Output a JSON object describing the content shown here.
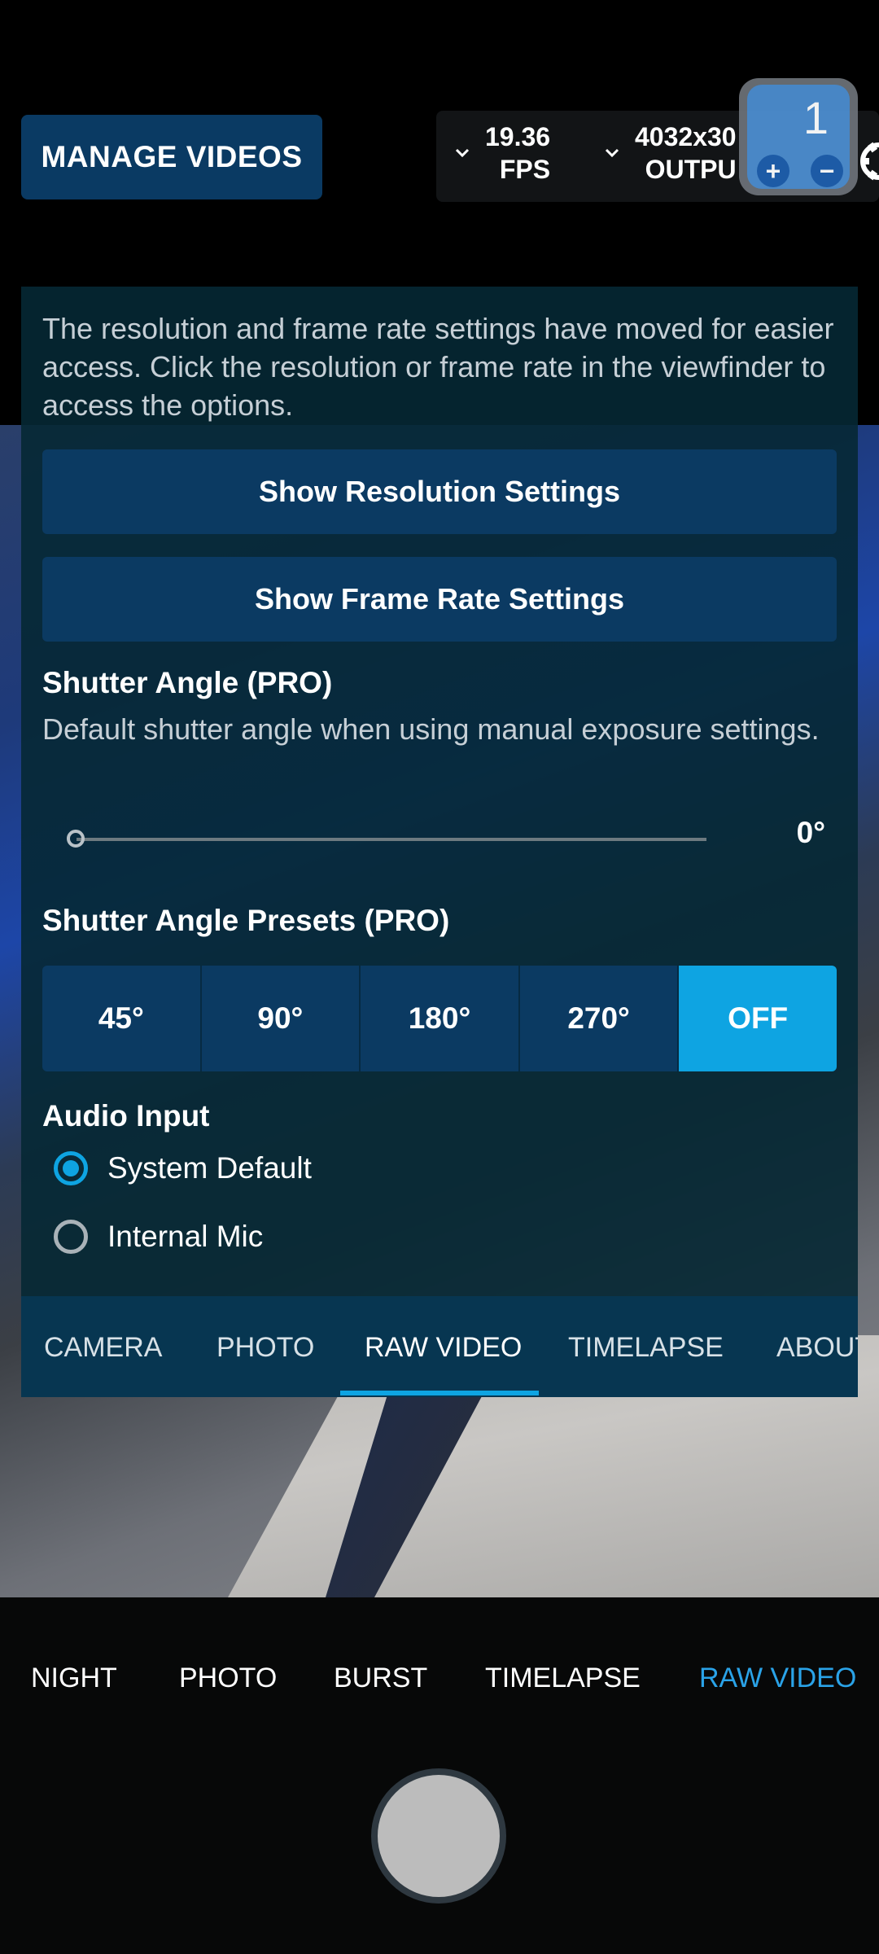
{
  "header": {
    "manage_videos_label": "MANAGE VIDEOS",
    "fps_value": "19.36",
    "fps_unit": "FPS",
    "resolution_value": "4032x30",
    "resolution_unit": "OUTPU",
    "counter_value": "1",
    "counter_plus": "+",
    "counter_minus": "−"
  },
  "panel": {
    "notice": "The resolution and frame rate settings have moved for easier access. Click the resolution or frame rate in the viewfinder to access the options.",
    "show_resolution_label": "Show Resolution Settings",
    "show_frame_rate_label": "Show Frame Rate Settings",
    "shutter_angle": {
      "title": "Shutter Angle (PRO)",
      "description": "Default shutter angle when using manual exposure settings.",
      "value_label": "0°",
      "value": 0
    },
    "presets": {
      "title": "Shutter Angle Presets (PRO)",
      "options": [
        "45°",
        "90°",
        "180°",
        "270°",
        "OFF"
      ],
      "selected": "OFF"
    },
    "audio": {
      "title": "Audio Input",
      "options": [
        "System Default",
        "Internal Mic"
      ],
      "selected": "System Default"
    },
    "tabs": [
      "CAMERA",
      "PHOTO",
      "RAW VIDEO",
      "TIMELAPSE",
      "ABOUT"
    ],
    "active_tab": "RAW VIDEO"
  },
  "modes": {
    "items": [
      "NIGHT",
      "PHOTO",
      "BURST",
      "TIMELAPSE",
      "RAW VIDEO"
    ],
    "active": "RAW VIDEO"
  },
  "colors": {
    "accent": "#0ea4e2",
    "button_bg": "#0b3a62",
    "panel_bg": "#062834"
  }
}
